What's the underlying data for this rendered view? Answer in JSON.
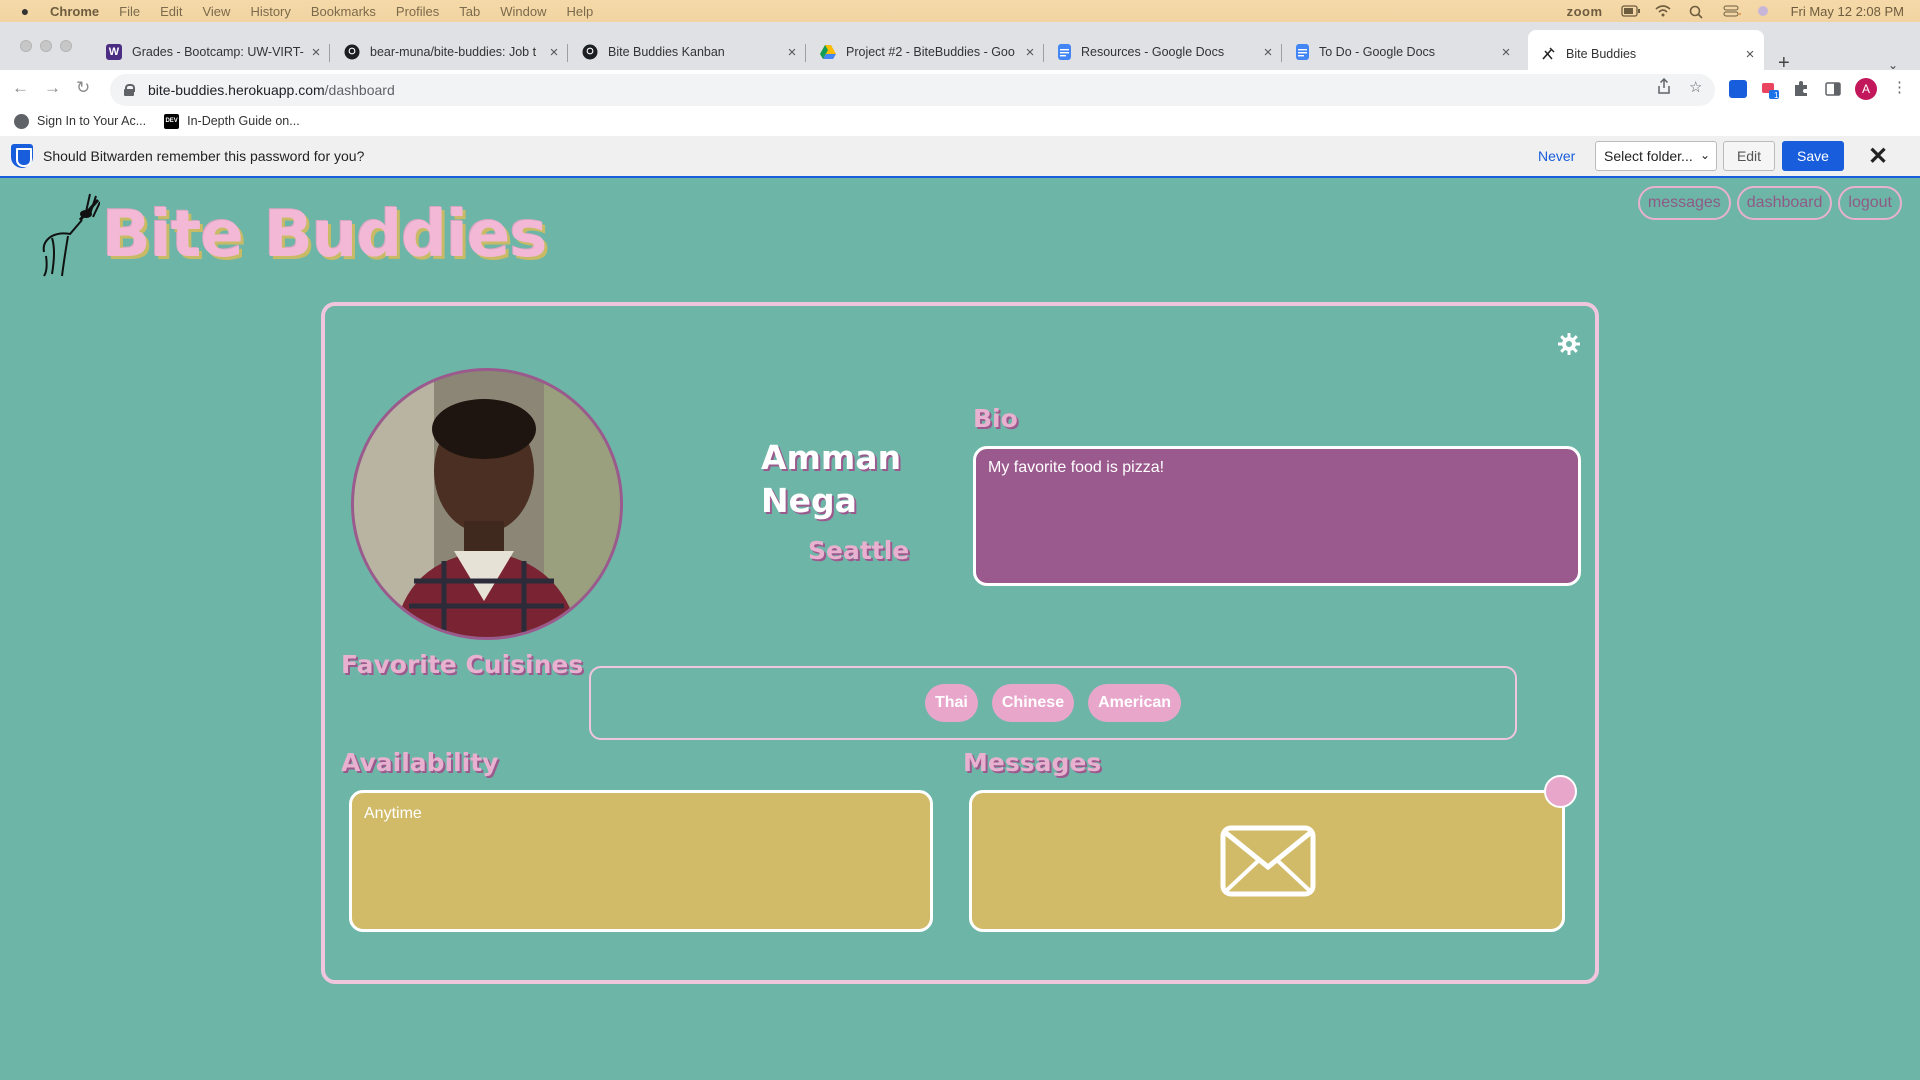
{
  "menubar": {
    "app_name": "Chrome",
    "items": [
      "File",
      "Edit",
      "View",
      "History",
      "Bookmarks",
      "Profiles",
      "Tab",
      "Window",
      "Help"
    ],
    "zoom_label": "zoom",
    "datetime": "Fri May 12  2:08 PM"
  },
  "tabs": [
    {
      "label": "Grades - Bootcamp: UW-VIRT-",
      "icon": "w-icon"
    },
    {
      "label": "bear-muna/bite-buddies: Job t",
      "icon": "github-icon"
    },
    {
      "label": "Bite Buddies Kanban",
      "icon": "github-icon"
    },
    {
      "label": "Project #2 - BiteBuddies - Goo",
      "icon": "drive-icon"
    },
    {
      "label": "Resources - Google Docs",
      "icon": "docs-icon"
    },
    {
      "label": "To Do - Google Docs",
      "icon": "docs-icon"
    },
    {
      "label": "Bite Buddies",
      "icon": "bite-buddies-icon"
    }
  ],
  "address": {
    "host": "bite-buddies.herokuapp.com",
    "path": "/dashboard"
  },
  "profile_initial": "A",
  "bookmarks": [
    {
      "label": "Sign In to Your Ac..."
    },
    {
      "label": "In-Depth Guide on..."
    }
  ],
  "bitwarden": {
    "prompt": "Should Bitwarden remember this password for you?",
    "never": "Never",
    "folder_select": "Select folder...",
    "edit": "Edit",
    "save": "Save"
  },
  "app": {
    "logo_text": "Bite Buddies",
    "nav": [
      "messages",
      "dashboard",
      "logout"
    ],
    "profile": {
      "first_name": "Amman",
      "last_name": "Nega",
      "city": "Seattle"
    },
    "bio_heading": "Bio",
    "bio_text": "My favorite food is pizza!",
    "cuisines_heading": "Favorite Cuisines",
    "cuisines": [
      "Thai",
      "Chinese",
      "American"
    ],
    "availability_heading": "Availability",
    "availability_text": "Anytime",
    "messages_heading": "Messages"
  },
  "colors": {
    "background": "#6db5a7",
    "pink": "#e8b1cf",
    "purple": "#9b5a8e",
    "gold": "#d1bb68",
    "bitwarden_blue": "#175ddc"
  }
}
